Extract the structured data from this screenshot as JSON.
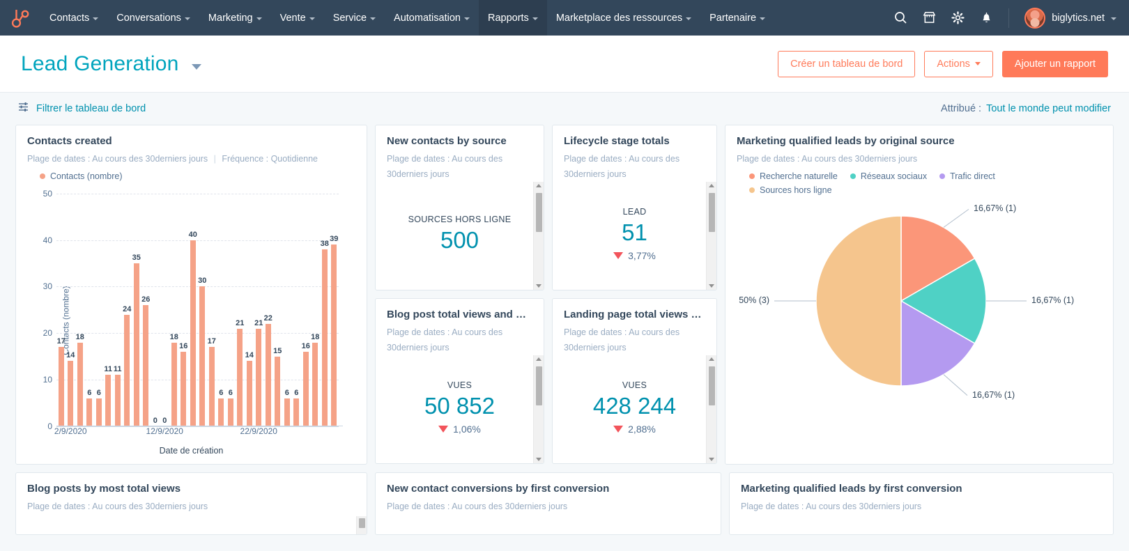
{
  "nav": {
    "logo_icon": "hubspot-sprocket-logo",
    "items": [
      {
        "label": "Contacts",
        "has_caret": true,
        "active": false
      },
      {
        "label": "Conversations",
        "has_caret": true,
        "active": false
      },
      {
        "label": "Marketing",
        "has_caret": true,
        "active": false
      },
      {
        "label": "Vente",
        "has_caret": true,
        "active": false
      },
      {
        "label": "Service",
        "has_caret": true,
        "active": false
      },
      {
        "label": "Automatisation",
        "has_caret": true,
        "active": false
      },
      {
        "label": "Rapports",
        "has_caret": true,
        "active": true
      },
      {
        "label": "Marketplace des ressources",
        "has_caret": true,
        "active": false
      },
      {
        "label": "Partenaire",
        "has_caret": true,
        "active": false
      }
    ],
    "icons": [
      "search-icon",
      "marketplace-icon",
      "gear-icon",
      "notifications-bell-icon"
    ],
    "account_name": "biglytics.net"
  },
  "header": {
    "dashboard_title": "Lead Generation",
    "create_dashboard_label": "Créer un tableau de bord",
    "actions_label": "Actions",
    "add_report_label": "Ajouter un rapport"
  },
  "filterbar": {
    "filter_label": "Filtrer le tableau de bord",
    "assigned_label": "Attribué :",
    "assigned_value": "Tout le monde peut modifier"
  },
  "colors": {
    "brand_orange": "#ff7a59",
    "teal": "#00a4bd",
    "navy": "#33475b",
    "bar_coral": "#f5a287",
    "pie_coral": "#fb9679",
    "pie_teal": "#4fd1c5",
    "pie_purple": "#b49af0",
    "pie_orange": "#f5c58d",
    "down_red": "#f2545b"
  },
  "cards": {
    "contacts_created": {
      "title": "Contacts created",
      "subtitle_range": "Plage de dates : Au cours des 30derniers jours",
      "subtitle_sep": "|",
      "subtitle_freq": "Fréquence : Quotidienne",
      "legend": [
        {
          "label": "Contacts (nombre)",
          "color": "#f5a287"
        }
      ]
    },
    "new_contacts_by_source": {
      "title": "New contacts by source",
      "subtitle_line1": "Plage de dates : Au cours des",
      "subtitle_line2": "30derniers jours",
      "kpi_label": "SOURCES HORS LIGNE",
      "kpi_value": "500",
      "kpi_delta": null
    },
    "lifecycle_stage_totals": {
      "title": "Lifecycle stage totals",
      "subtitle_line1": "Plage de dates : Au cours des",
      "subtitle_line2": "30derniers jours",
      "kpi_label": "LEAD",
      "kpi_value": "51",
      "kpi_delta": "3,77%",
      "kpi_delta_direction": "down"
    },
    "blog_post_total_views": {
      "title": "Blog post total views and bo...",
      "subtitle_line1": "Plage de dates : Au cours des",
      "subtitle_line2": "30derniers jours",
      "kpi_label": "VUES",
      "kpi_value": "50 852",
      "kpi_delta": "1,06%",
      "kpi_delta_direction": "down"
    },
    "landing_page_total_views": {
      "title": "Landing page total views an...",
      "subtitle_line1": "Plage de dates : Au cours des",
      "subtitle_line2": "30derniers jours",
      "kpi_label": "VUES",
      "kpi_value": "428 244",
      "kpi_delta": "2,88%",
      "kpi_delta_direction": "down"
    },
    "mql_by_original_source": {
      "title": "Marketing qualified leads by original source",
      "subtitle_range": "Plage de dates : Au cours des 30derniers jours",
      "legend": [
        {
          "label": "Recherche naturelle",
          "color": "#fb9679"
        },
        {
          "label": "Réseaux sociaux",
          "color": "#4fd1c5"
        },
        {
          "label": "Trafic direct",
          "color": "#b49af0"
        },
        {
          "label": "Sources hors ligne",
          "color": "#f5c58d"
        }
      ]
    },
    "blog_posts_by_most_total_views": {
      "title": "Blog posts by most total views",
      "subtitle_range": "Plage de dates : Au cours des 30derniers jours"
    },
    "new_contact_conversions": {
      "title": "New contact conversions by first conversion",
      "subtitle_range": "Plage de dates : Au cours des 30derniers jours"
    },
    "mql_by_first_conversion": {
      "title": "Marketing qualified leads by first conversion",
      "subtitle_range": "Plage de dates : Au cours des 30derniers jours"
    }
  },
  "chart_data": [
    {
      "id": "contacts-created-bar",
      "type": "bar",
      "title": "Contacts created",
      "xlabel": "Date de création",
      "ylabel": "Contacts (nombre)",
      "ylim": [
        0,
        50
      ],
      "yticks": [
        0,
        10,
        20,
        30,
        40,
        50
      ],
      "grid": true,
      "legend": [
        "Contacts (nombre)"
      ],
      "series_color": "#f5a287",
      "xtick_labels": [
        "2/9/2020",
        "12/9/2020",
        "22/9/2020"
      ],
      "xtick_indices": [
        1,
        11,
        21
      ],
      "categories": [
        "1",
        "2",
        "3",
        "4",
        "5",
        "6",
        "7",
        "8",
        "9",
        "10",
        "11",
        "12",
        "13",
        "14",
        "15",
        "16",
        "17",
        "18",
        "19",
        "20",
        "21",
        "22",
        "23",
        "24",
        "25",
        "26",
        "27"
      ],
      "values": [
        17,
        14,
        18,
        6,
        6,
        11,
        11,
        24,
        35,
        26,
        0,
        0,
        18,
        16,
        40,
        30,
        17,
        6,
        6,
        21,
        14,
        21,
        22,
        15,
        6,
        6,
        16,
        18,
        38,
        39
      ]
    },
    {
      "id": "mql-original-source-pie",
      "type": "pie",
      "title": "Marketing qualified leads by original source",
      "legend_position": "top",
      "labels": [
        "Recherche naturelle",
        "Réseaux sociaux",
        "Trafic direct",
        "Sources hors ligne"
      ],
      "values": [
        1,
        1,
        1,
        3
      ],
      "percents": [
        16.67,
        16.67,
        16.67,
        50
      ],
      "data_labels": [
        "16,67% (1)",
        "16,67% (1)",
        "16,67% (1)",
        "50% (3)"
      ],
      "colors": [
        "#fb9679",
        "#4fd1c5",
        "#b49af0",
        "#f5c58d"
      ]
    }
  ]
}
